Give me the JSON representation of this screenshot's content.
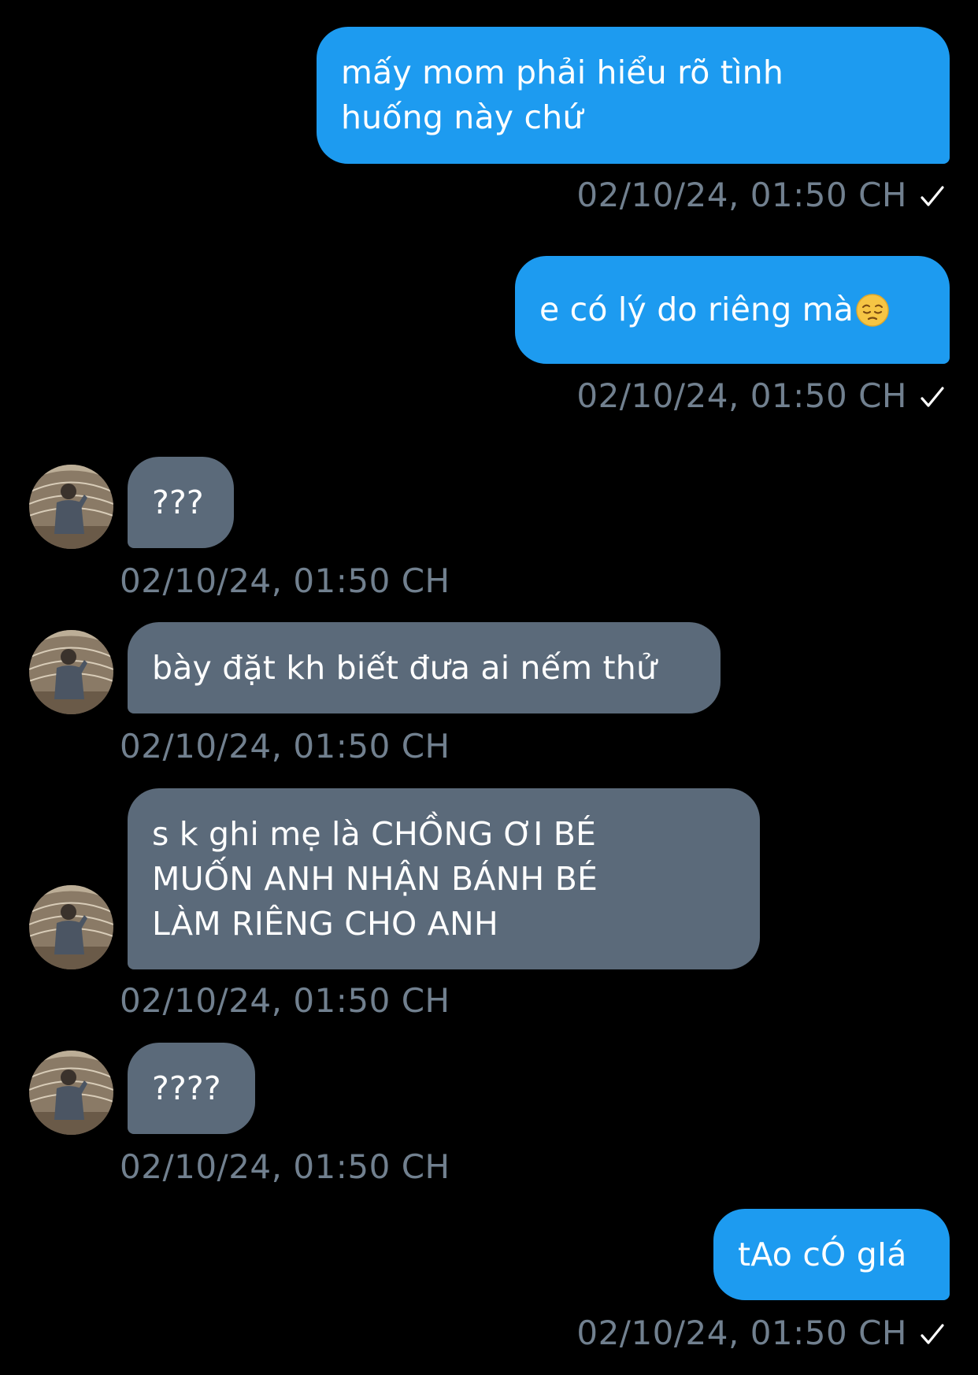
{
  "conversation": {
    "messages": [
      {
        "direction": "sent",
        "text": "mấy mom phải hiểu rõ tình\nhuống này chứ",
        "timestamp": "02/10/24, 01:50 CH",
        "read": true
      },
      {
        "direction": "sent",
        "text": "e có lý do riêng mà",
        "emoji": "pensive-face",
        "timestamp": "02/10/24, 01:50 CH",
        "read": true
      },
      {
        "direction": "received",
        "text": "???",
        "timestamp": "02/10/24, 01:50 CH"
      },
      {
        "direction": "received",
        "text": "bày đặt kh biết đưa ai nếm thử",
        "timestamp": "02/10/24, 01:50 CH"
      },
      {
        "direction": "received",
        "text": "s k ghi mẹ là CHỒNG ƠI BÉ\nMUỐN ANH NHẬN BÁNH BÉ\nLÀM RIÊNG CHO ANH",
        "timestamp": "02/10/24, 01:50 CH"
      },
      {
        "direction": "received",
        "text": "????",
        "timestamp": "02/10/24, 01:50 CH"
      },
      {
        "direction": "sent",
        "text": "tAo cÓ gIá",
        "timestamp": "02/10/24, 01:50 CH",
        "read": true
      }
    ]
  },
  "colors": {
    "background": "#000000",
    "sent_bubble": "#1d9bf0",
    "received_bubble": "#5b6a7a",
    "timestamp": "#71808f"
  }
}
